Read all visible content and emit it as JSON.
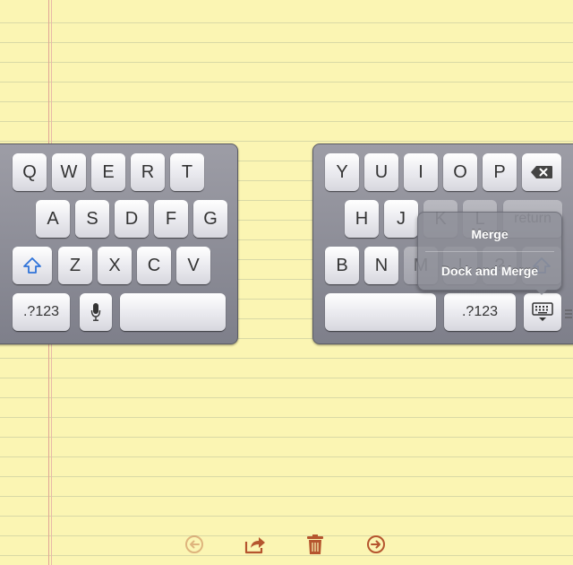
{
  "keyboard": {
    "left": {
      "row1": [
        "Q",
        "W",
        "E",
        "R",
        "T"
      ],
      "row2": [
        "A",
        "S",
        "D",
        "F",
        "G"
      ],
      "row3": [
        "Z",
        "X",
        "C",
        "V"
      ],
      "numbers_label": ".?123"
    },
    "right": {
      "row1": [
        "Y",
        "U",
        "I",
        "O",
        "P"
      ],
      "row2": [
        "H",
        "J",
        "K",
        "L"
      ],
      "return_label": "return",
      "row3": [
        "B",
        "N",
        "M",
        "!",
        "?"
      ],
      "numbers_label": ".?123"
    }
  },
  "popup": {
    "merge_label": "Merge",
    "dock_merge_label": "Dock and Merge"
  },
  "toolbar": {
    "icons": [
      "back-icon",
      "share-icon",
      "trash-icon",
      "forward-icon"
    ]
  },
  "colors": {
    "paper": "#fbf5b3",
    "rule_line": "#d9d9a6",
    "margin_line": "#e1a595",
    "toolbar_icon": "#b5552e",
    "shift_arrow": "#2f73d9"
  }
}
